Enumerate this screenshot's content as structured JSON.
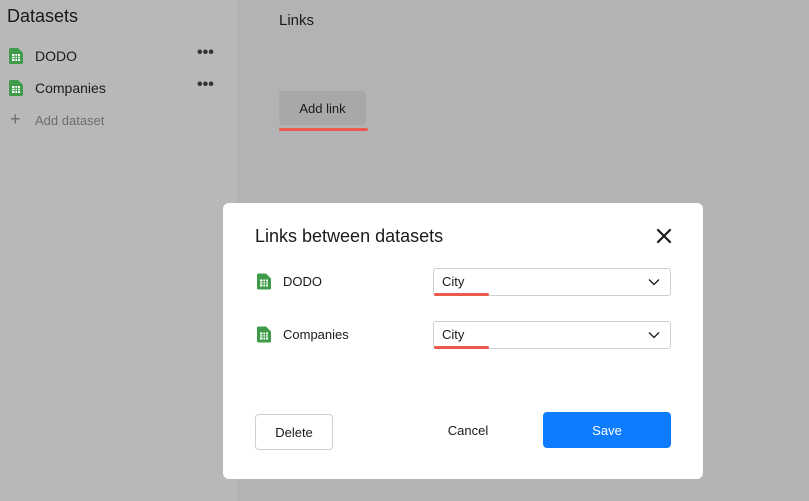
{
  "colors": {
    "accent_red": "#ec5a4f",
    "primary_blue": "#0d7cff",
    "sheet_green": "#3f9b4a"
  },
  "sidebar": {
    "title": "Datasets",
    "items": [
      {
        "label": "DODO",
        "icon": "spreadsheet-icon",
        "menu": "•••"
      },
      {
        "label": "Companies",
        "icon": "spreadsheet-icon",
        "menu": "•••"
      }
    ],
    "add_label": "Add dataset",
    "add_icon": "+"
  },
  "main": {
    "title": "Links",
    "add_link_label": "Add link"
  },
  "modal": {
    "title": "Links between datasets",
    "rows": [
      {
        "dataset": "DODO",
        "field": "City"
      },
      {
        "dataset": "Companies",
        "field": "City"
      }
    ],
    "delete_label": "Delete",
    "cancel_label": "Cancel",
    "save_label": "Save"
  }
}
